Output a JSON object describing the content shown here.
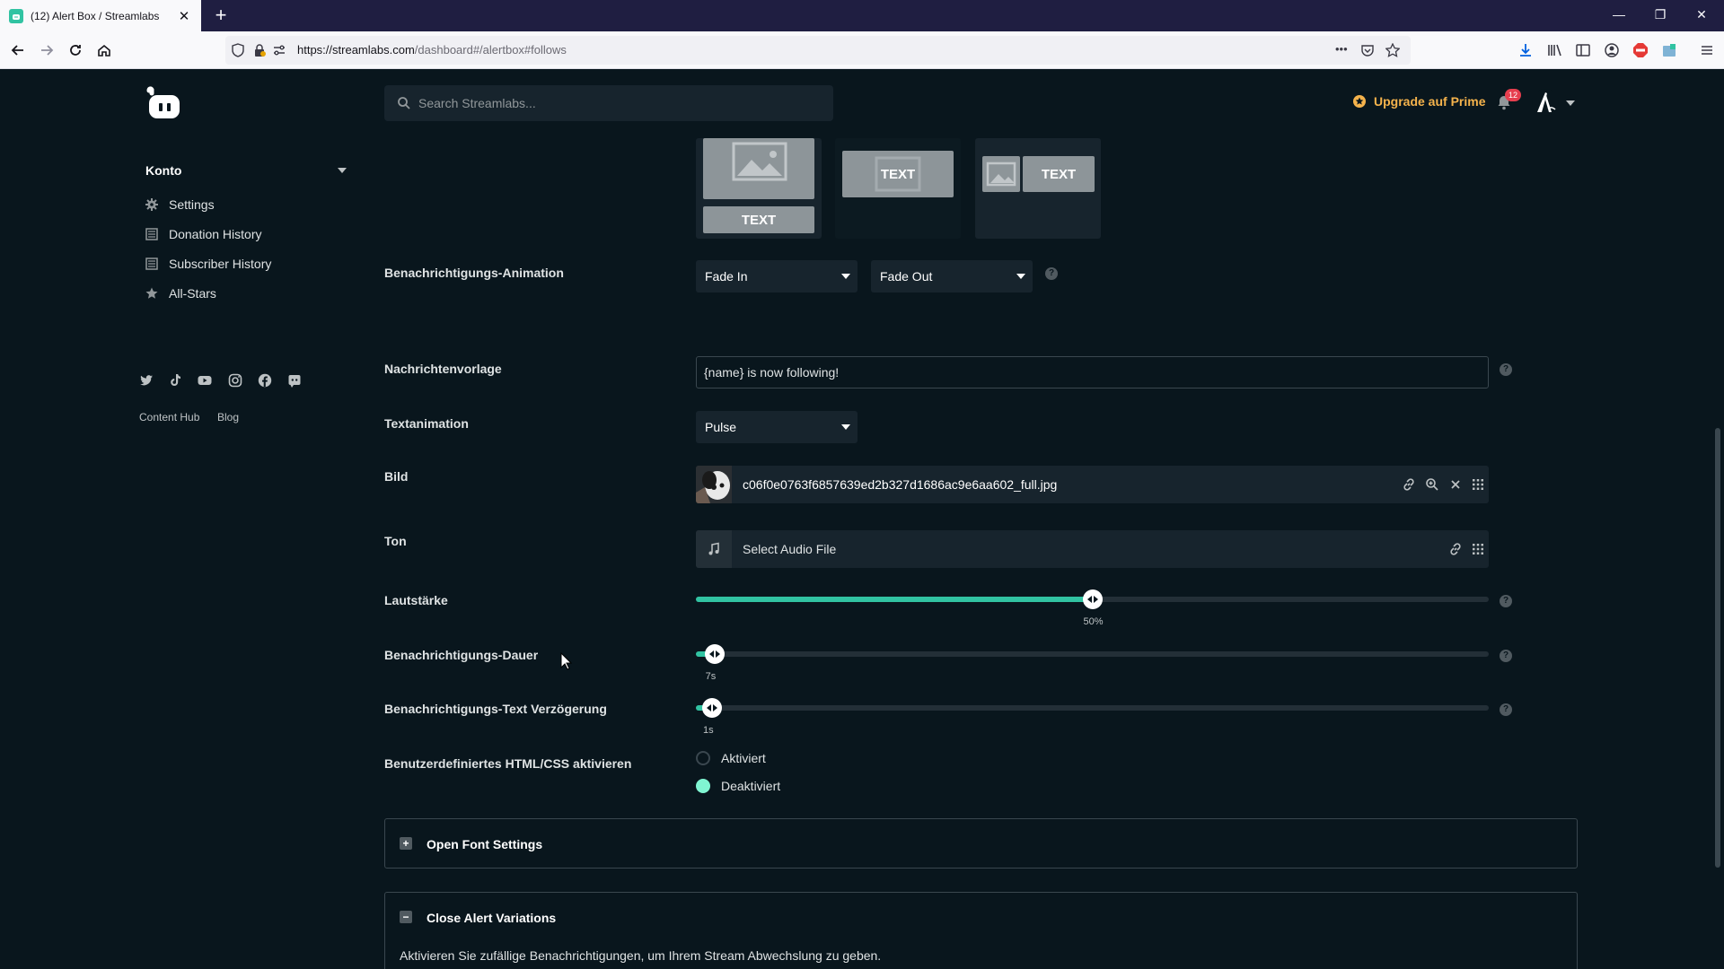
{
  "browser": {
    "tab_title": "(12) Alert Box / Streamlabs",
    "url_host": "https://streamlabs.com",
    "url_path": "/dashboard#/alertbox#follows",
    "url_more": "•••"
  },
  "sidebar": {
    "section_label": "Konto",
    "items": [
      {
        "label": "Settings",
        "icon": "gear-icon"
      },
      {
        "label": "Donation History",
        "icon": "list-icon"
      },
      {
        "label": "Subscriber History",
        "icon": "list-icon"
      },
      {
        "label": "All-Stars",
        "icon": "star-icon"
      }
    ],
    "socials": [
      "twitter-icon",
      "tiktok-icon",
      "youtube-icon",
      "instagram-icon",
      "facebook-icon",
      "discord-icon"
    ],
    "footer_links": [
      "Content Hub",
      "Blog"
    ]
  },
  "header": {
    "search_placeholder": "Search Streamlabs...",
    "upgrade_label": "Upgrade auf Prime",
    "notification_count": "12"
  },
  "layouts": {
    "labels": [
      "TEXT",
      "TEXT",
      "TEXT"
    ]
  },
  "form": {
    "animation": {
      "label": "Benachrichtigungs-Animation",
      "in_value": "Fade In",
      "out_value": "Fade Out"
    },
    "message_template": {
      "label": "Nachrichtenvorlage",
      "value": "{name} is now following!"
    },
    "text_animation": {
      "label": "Textanimation",
      "value": "Pulse"
    },
    "image": {
      "label": "Bild",
      "filename": "c06f0e0763f6857639ed2b327d1686ac9e6aa602_full.jpg"
    },
    "sound": {
      "label": "Ton",
      "placeholder": "Select Audio File"
    },
    "volume": {
      "label": "Lautstärke",
      "value": 50,
      "value_label": "50%"
    },
    "duration": {
      "label": "Benachrichtigungs-Dauer",
      "value": 7,
      "value_label": "7s"
    },
    "text_delay": {
      "label": "Benachrichtigungs-Text Verzögerung",
      "value": 1,
      "value_label": "1s"
    },
    "custom_html": {
      "label": "Benutzerdefiniertes HTML/CSS aktivieren",
      "option_on": "Aktiviert",
      "option_off": "Deaktiviert",
      "selected": "Deaktiviert"
    }
  },
  "panels": {
    "font_settings": {
      "title": "Open Font Settings",
      "toggle": "+"
    },
    "alert_variations": {
      "title": "Close Alert Variations",
      "toggle": "−",
      "description": "Aktivieren Sie zufällige Benachrichtigungen, um Ihrem Stream Abwechslung zu geben."
    }
  },
  "colors": {
    "accent": "#31c3a2",
    "background": "#09161d",
    "prime": "#f5b34c"
  }
}
